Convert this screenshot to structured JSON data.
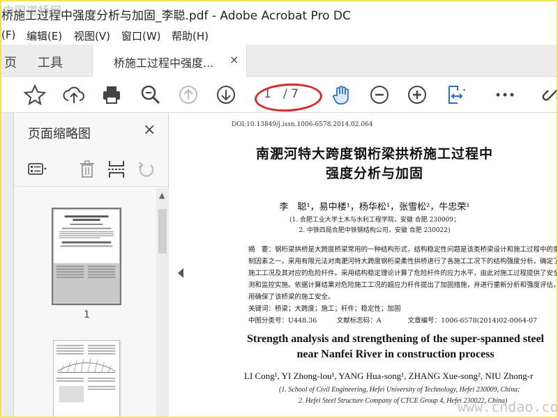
{
  "window": {
    "title": "桥施工过程中强度分析与加固_李聪.pdf - Adobe Acrobat Pro DC",
    "watermark_top": "中国道桥网"
  },
  "menu": [
    "(F)",
    "编辑(E)",
    "视图(V)",
    "窗口(W)",
    "帮助(H)"
  ],
  "tabs": {
    "home": "页",
    "tools": "工具",
    "doc": "桥施工过程中强度...",
    "close": "×"
  },
  "toolbar": {
    "icons": [
      "star-icon",
      "cloud-upload-icon",
      "print-icon",
      "zoom-search-icon",
      "page-up-icon",
      "page-down-icon",
      "hand-tool-icon",
      "zoom-out-icon",
      "zoom-in-icon",
      "fit-page-icon",
      "more-icon",
      "link-icon"
    ],
    "page_current": "1",
    "page_total": "/ 7",
    "annotation_color": "#d9262a"
  },
  "sidepanel": {
    "title": "页面缩略图",
    "close": "×",
    "thumbnails": [
      {
        "label": "1"
      },
      {
        "label": ""
      }
    ]
  },
  "document": {
    "doi": "DOI:10.13849/j.issn.1006-6578.2014.02.064",
    "title_line1": "南淝河特大跨度钢桁梁拱桥施工过程中",
    "title_line2": "强度分析与加固",
    "authors": "李　聪¹，易中楼¹，杨华松¹，张雪松²，牛忠荣¹",
    "affil1": "(1. 合肥工业大学土木与水利工程学院，安徽 合肥 230009；",
    "affil2": "2. 中铁四局合肥中铁钢结构公司，安徽 合肥 230022)",
    "abstract_lines": [
      "摘　要：钢桁梁拱桥是大跨度桥梁常用的一种结构形式，结构稳定性问题是该类桥梁设计和施工过程中的重",
      "制因素之一。采用有限元法对南淝河特大跨度钢桁梁柔性拱桥进行了各施工工况下的结构强度分析，确定了",
      "施工工况及其对应的危险杆件。采用结构稳定理论计算了危险杆件的应力水平，由此对施工过程提供了安全",
      "测和监控实施。依据计算结果对危险施工工况的超应力杆件提出了加固措施，并进行重新分析和强度评估，其加",
      "用确保了该桥梁的施工安全。",
      "关键词：桥梁；大跨度；施工；杆件；稳定性；加固",
      "中图分类号：U448.36　　　文献标志码：A　　　　文章编号：1006-6578(2014)02-0064-07"
    ],
    "en_title_line1": "Strength analysis and strengthening of the super-spanned steel",
    "en_title_line2": "near Nanfei River in construction process",
    "en_authors": "LI Cong¹, YI Zhong-lou¹, YANG Hua-song¹, ZHANG Xue-song², NIU Zhong-r",
    "en_affil1": "(1. School of Civil Engineering, Hefei University of Technology, Hefei 230009, China;",
    "en_affil2": "2. Hefei Steel Structure Company of CTCE Group 4, Hefei 230022, China)",
    "watermark_bot": "www.cndao.com"
  }
}
